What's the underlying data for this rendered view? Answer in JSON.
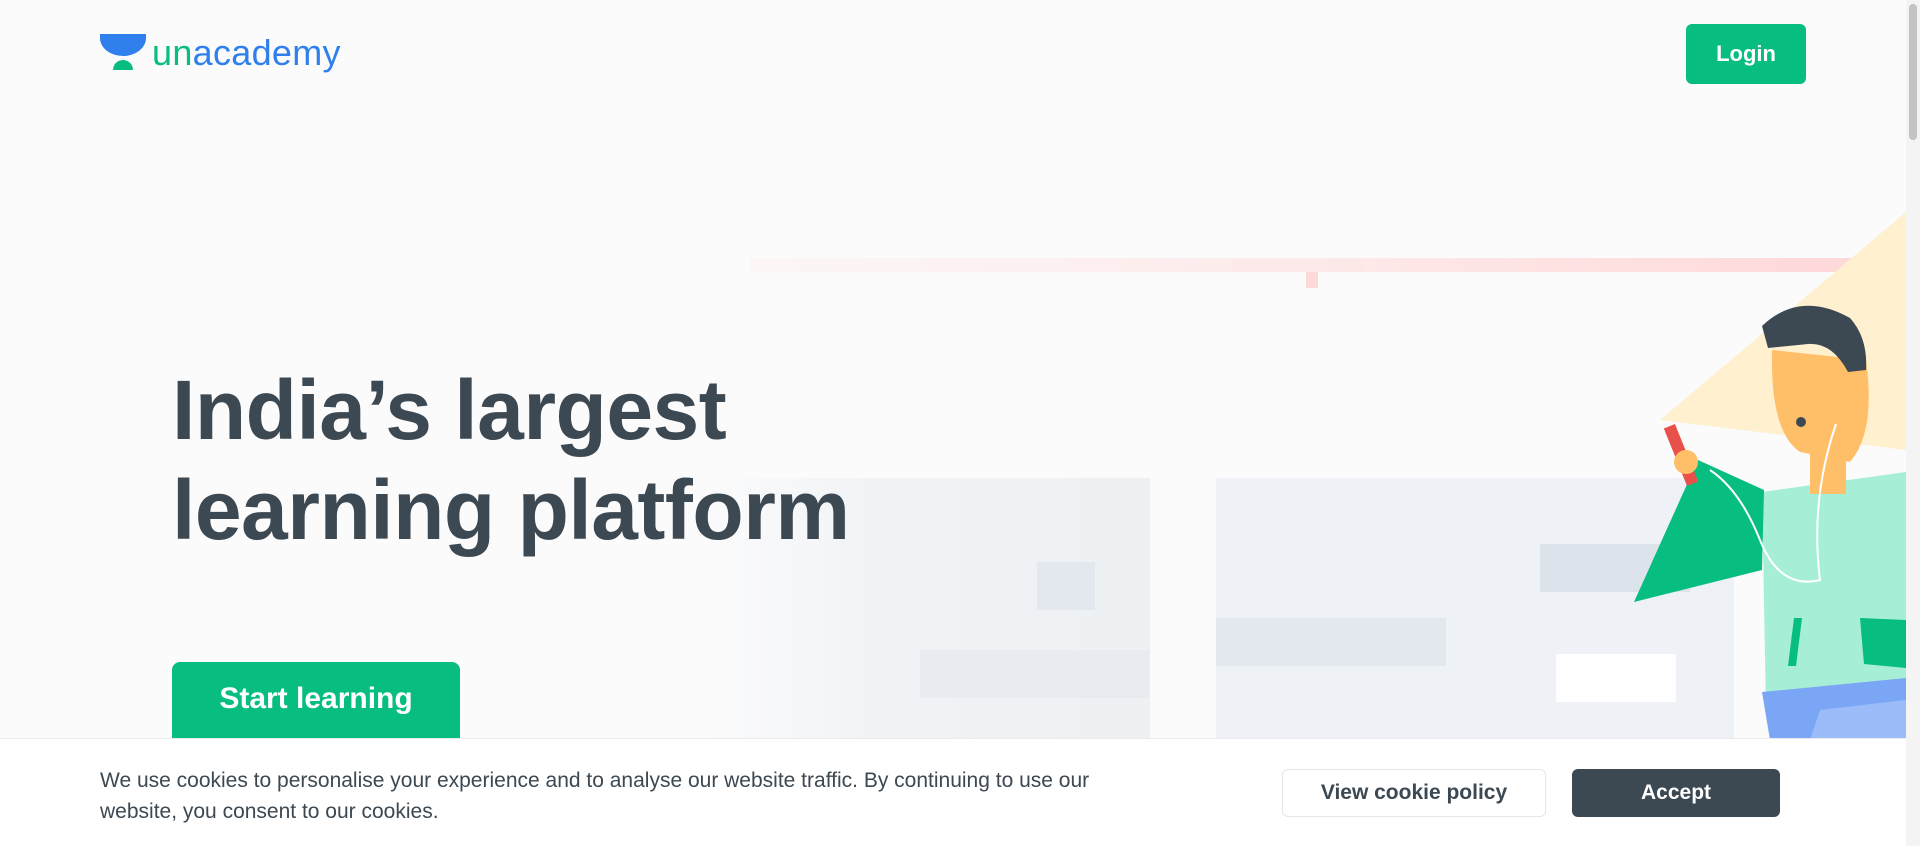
{
  "header": {
    "logo_text_primary": "un",
    "logo_text_accent": "academy",
    "login_label": "Login"
  },
  "hero": {
    "title_line1": "India’s largest",
    "title_line2": "learning platform",
    "cta_label": "Start learning"
  },
  "cookie_banner": {
    "message": "We use cookies to personalise your experience and to analyse our website traffic. By continuing to use our website, you consent to our cookies.",
    "policy_label": "View cookie policy",
    "accept_label": "Accept"
  },
  "colors": {
    "brand_green": "#08bd80",
    "brand_blue": "#2f80ed",
    "dark_slate": "#3c4852"
  },
  "icons": [
    "unacademy-logo-icon"
  ]
}
